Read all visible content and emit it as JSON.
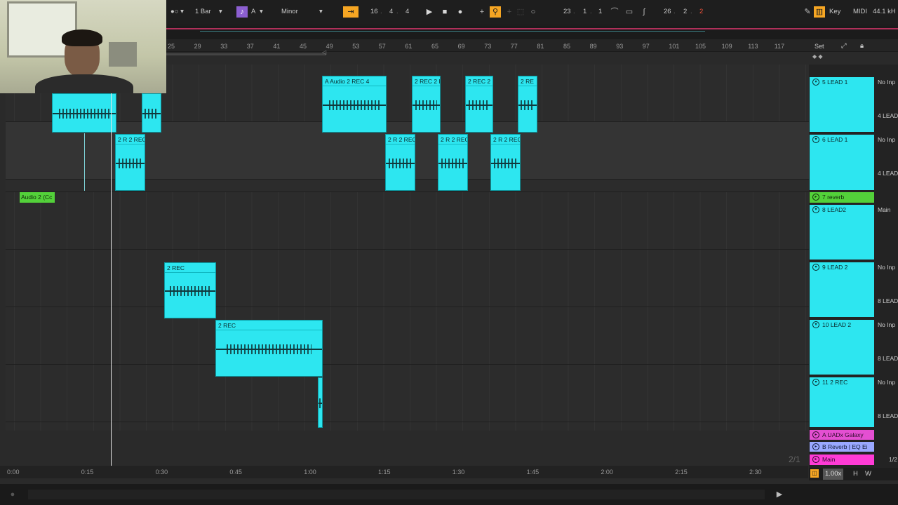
{
  "toolbar": {
    "quantize": "1 Bar",
    "key": "A",
    "scale": "Minor",
    "position": [
      "16",
      "4",
      "4"
    ],
    "loop_start": [
      "23",
      "1",
      "1"
    ],
    "loop_length": [
      "26",
      "2",
      "2"
    ],
    "key_label": "Key",
    "midi_label": "MIDI",
    "sample_rate": "44.1 kH"
  },
  "ruler": {
    "ticks": [
      "25",
      "29",
      "33",
      "37",
      "41",
      "45",
      "49",
      "53",
      "57",
      "61",
      "65",
      "69",
      "73",
      "77",
      "81",
      "85",
      "89",
      "93",
      "97",
      "101",
      "105",
      "109",
      "113",
      "117"
    ],
    "set_button": "Set"
  },
  "tracks": [
    {
      "name": "5 LEAD 1",
      "input": "No Inp",
      "output": "4 LEAD"
    },
    {
      "name": "6 LEAD 1",
      "input": "No Inp",
      "output": "4 LEAD"
    },
    {
      "name": "7 reverb"
    },
    {
      "name": "8 LEAD2",
      "output": "Main"
    },
    {
      "name": "9 LEAD 2",
      "input": "No Inp",
      "output": "8 LEAD"
    },
    {
      "name": "10 LEAD 2",
      "input": "No Inp",
      "output": "8 LEAD"
    },
    {
      "name": "11 2 REC",
      "input": "No Inp",
      "output": "8 LEAD"
    }
  ],
  "returns": [
    {
      "name": "A UADx Galaxy"
    },
    {
      "name": "B Reverb | EQ Ei"
    },
    {
      "name": "Main"
    }
  ],
  "clip_labels": {
    "audio_clip": "Audio 2 (Cc",
    "a_audio": "A Audio",
    "rec4": "2 REC 4",
    "rec": "2 REC",
    "rec_short": "2 REC 2 F",
    "rec_trunc": "2 REC",
    "rec_r": "2 RE",
    "rec_2r": "2 R",
    "rec_lead": "2 R 2 REC"
  },
  "timeline": {
    "labels": [
      "0:00",
      "0:15",
      "0:30",
      "0:45",
      "1:00",
      "1:15",
      "1:30",
      "1:45",
      "2:00",
      "2:15",
      "2:30"
    ],
    "page": "2/1",
    "zoom": "1.00x",
    "ratio": "1/2",
    "h_button": "H",
    "w_button": "W"
  },
  "colors": {
    "clip": "#2de6f0",
    "reverb": "#53d13a",
    "returns": "#e44fd2",
    "main": "#ff3bd6",
    "accent": "#f6a623"
  }
}
